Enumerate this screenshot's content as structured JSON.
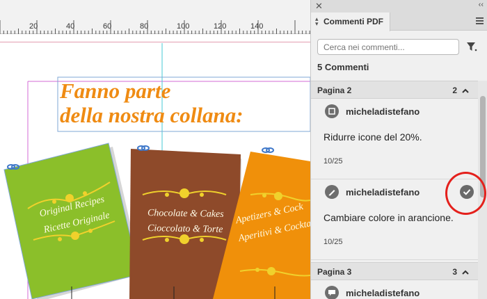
{
  "ruler": {
    "ticks": [
      "20",
      "40",
      "60",
      "80",
      "100",
      "120",
      "140"
    ]
  },
  "document": {
    "heading_line1": "Fanno parte",
    "heading_line2": "della nostra collana:",
    "cards": [
      {
        "line1": "Original Recipes",
        "line2": "Ricette Originale",
        "color": "#8bbf2a"
      },
      {
        "line1": "Chocolate & Cakes",
        "line2": "Cioccolato & Torte",
        "color": "#8e4a2a"
      },
      {
        "line1": "Apetizers & Cock",
        "line2": "Aperitivi & Cockta",
        "color": "#f0900a"
      }
    ],
    "heading_color": "#ef8b13"
  },
  "panel": {
    "close_glyph": "✕",
    "collapse_glyph": "‹‹",
    "tab_label": "Commenti PDF",
    "search_placeholder": "Cerca nei commenti...",
    "count_label": "5 Commenti",
    "sections": [
      {
        "title": "Pagina 2",
        "count": "2",
        "comments": [
          {
            "author": "micheladistefano",
            "icon": "square-note-icon",
            "text": "Ridurre icone del 20%.",
            "page": "10/25"
          },
          {
            "author": "micheladistefano",
            "icon": "pencil-icon",
            "text": "Cambiare colore in arancione.",
            "page": "10/25",
            "resolved_icon": "checkmark-icon"
          }
        ]
      },
      {
        "title": "Pagina 3",
        "count": "3",
        "comments": [
          {
            "author": "micheladistefano",
            "icon": "speech-bubble-icon"
          }
        ]
      }
    ],
    "highlight_color": "#e4201c"
  }
}
